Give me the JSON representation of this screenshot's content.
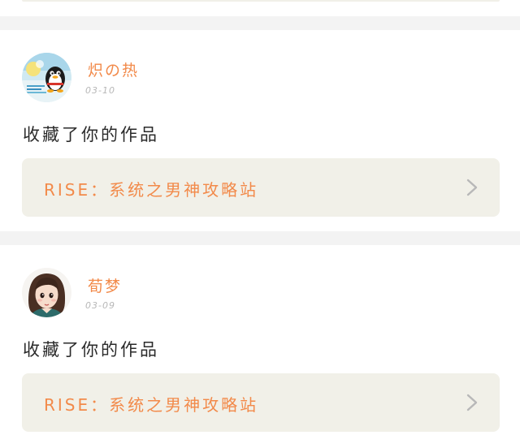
{
  "feed": {
    "items": [
      {
        "user": {
          "name": "炽の热",
          "avatar": "qq-penguin-avatar"
        },
        "date": "03-10",
        "action": "收藏了你的作品",
        "work": {
          "title": "RISE：系统之男神攻略站"
        }
      },
      {
        "user": {
          "name": "荀梦",
          "avatar": "illustrated-girl-avatar"
        },
        "date": "03-09",
        "action": "收藏了你的作品",
        "work": {
          "title": "RISE：系统之男神攻略站"
        }
      }
    ]
  },
  "colors": {
    "accent": "#f28a4a",
    "card_link_bg": "#f1f0e8",
    "page_bg": "#f3f3f3",
    "date": "#b7b7b7",
    "text": "#2a2a2a",
    "chevron": "#b8b8b8"
  },
  "icons": {
    "chevron": "chevron-right-icon"
  }
}
